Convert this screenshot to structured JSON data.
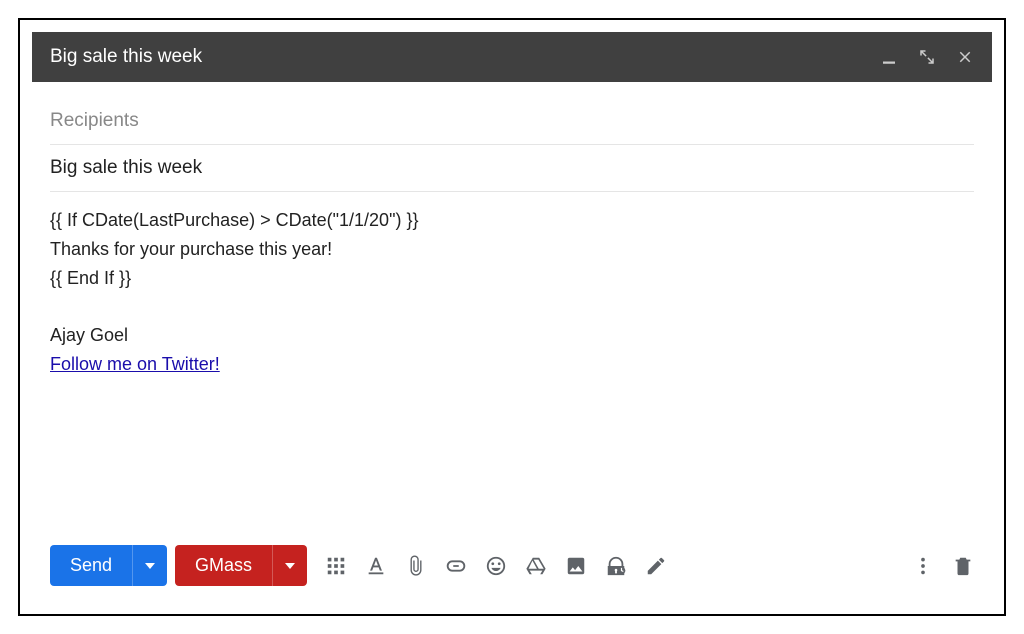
{
  "titlebar": {
    "title": "Big sale this week"
  },
  "fields": {
    "recipients_placeholder": "Recipients",
    "subject_value": "Big sale this week"
  },
  "body": {
    "line1": "{{ If CDate(LastPurchase) > CDate(\"1/1/20\") }}",
    "line2": "Thanks for your purchase this year!",
    "line3": "{{ End If }}",
    "signature_name": "Ajay Goel",
    "twitter_link_text": "Follow me on Twitter!"
  },
  "toolbar": {
    "send_label": "Send",
    "gmass_label": "GMass"
  }
}
